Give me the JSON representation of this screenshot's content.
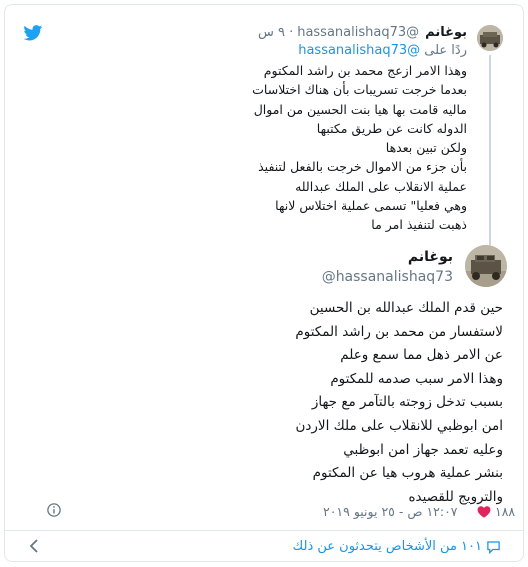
{
  "parent_tweet": {
    "name": "بوغانم",
    "handle": "@hassanalishaq73",
    "time": "٩ س",
    "reply_prefix": "ردًا على",
    "reply_to": "@hassanalishaq73",
    "lines": [
      "وهذا الامر ازعج محمد بن راشد المكتوم",
      "بعدما خرجت تسريبات بأن هناك اختلاسات",
      "ماليه قامت بها هيا بنت الحسين من اموال",
      "الدوله كانت عن طريق مكتبها",
      "ولكن تبين بعدها",
      "بأن جزء من الاموال خرجت بالفعل لتنفيذ",
      "عملية الانقلاب على الملك عبدالله",
      "وهي فعليا\" تسمى عملية اختلاس لانها",
      "ذهبت لتنفيذ امر ما"
    ]
  },
  "main_tweet": {
    "name": "بوغانم",
    "handle": "@hassanalishaq73",
    "lines": [
      "حين قدم الملك عبدالله بن الحسين",
      "لاستفسار من محمد بن راشد المكتوم",
      "عن الامر ذهل مما سمع وعلم",
      "وهذا الامر سبب صدمه للمكتوم",
      "بسبب تدخل زوجته بالتآمر مع جهاز",
      "امن ابوظبي للانقلاب على ملك الاردن",
      "وعليه تعمد جهاز امن ابوظبي",
      "بنشر عملية هروب هيا عن المكتوم",
      "والترويج للقصيده"
    ],
    "like_count": "١٨٨",
    "timestamp": "١٢:٠٧ ص - ٢٥ يونيو ٢٠١٩"
  },
  "footer": {
    "text": "١٠١ من الأشخاص يتحدثون عن ذلك"
  },
  "colors": {
    "brand_blue": "#1da1f2",
    "like_red": "#e0245e",
    "link": "#1b95e0"
  }
}
